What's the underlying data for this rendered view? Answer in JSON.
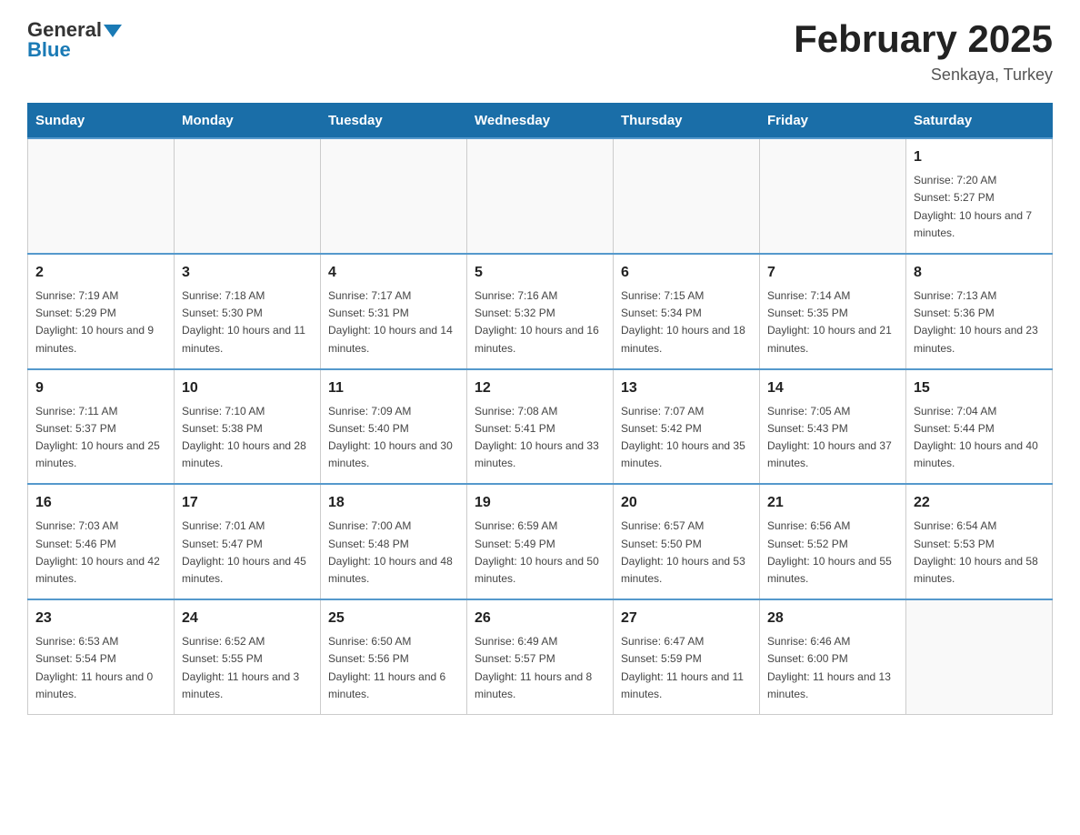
{
  "header": {
    "logo_general": "General",
    "logo_blue": "Blue",
    "title": "February 2025",
    "subtitle": "Senkaya, Turkey"
  },
  "days_of_week": [
    "Sunday",
    "Monday",
    "Tuesday",
    "Wednesday",
    "Thursday",
    "Friday",
    "Saturday"
  ],
  "weeks": [
    [
      {
        "day": "",
        "info": ""
      },
      {
        "day": "",
        "info": ""
      },
      {
        "day": "",
        "info": ""
      },
      {
        "day": "",
        "info": ""
      },
      {
        "day": "",
        "info": ""
      },
      {
        "day": "",
        "info": ""
      },
      {
        "day": "1",
        "info": "Sunrise: 7:20 AM\nSunset: 5:27 PM\nDaylight: 10 hours and 7 minutes."
      }
    ],
    [
      {
        "day": "2",
        "info": "Sunrise: 7:19 AM\nSunset: 5:29 PM\nDaylight: 10 hours and 9 minutes."
      },
      {
        "day": "3",
        "info": "Sunrise: 7:18 AM\nSunset: 5:30 PM\nDaylight: 10 hours and 11 minutes."
      },
      {
        "day": "4",
        "info": "Sunrise: 7:17 AM\nSunset: 5:31 PM\nDaylight: 10 hours and 14 minutes."
      },
      {
        "day": "5",
        "info": "Sunrise: 7:16 AM\nSunset: 5:32 PM\nDaylight: 10 hours and 16 minutes."
      },
      {
        "day": "6",
        "info": "Sunrise: 7:15 AM\nSunset: 5:34 PM\nDaylight: 10 hours and 18 minutes."
      },
      {
        "day": "7",
        "info": "Sunrise: 7:14 AM\nSunset: 5:35 PM\nDaylight: 10 hours and 21 minutes."
      },
      {
        "day": "8",
        "info": "Sunrise: 7:13 AM\nSunset: 5:36 PM\nDaylight: 10 hours and 23 minutes."
      }
    ],
    [
      {
        "day": "9",
        "info": "Sunrise: 7:11 AM\nSunset: 5:37 PM\nDaylight: 10 hours and 25 minutes."
      },
      {
        "day": "10",
        "info": "Sunrise: 7:10 AM\nSunset: 5:38 PM\nDaylight: 10 hours and 28 minutes."
      },
      {
        "day": "11",
        "info": "Sunrise: 7:09 AM\nSunset: 5:40 PM\nDaylight: 10 hours and 30 minutes."
      },
      {
        "day": "12",
        "info": "Sunrise: 7:08 AM\nSunset: 5:41 PM\nDaylight: 10 hours and 33 minutes."
      },
      {
        "day": "13",
        "info": "Sunrise: 7:07 AM\nSunset: 5:42 PM\nDaylight: 10 hours and 35 minutes."
      },
      {
        "day": "14",
        "info": "Sunrise: 7:05 AM\nSunset: 5:43 PM\nDaylight: 10 hours and 37 minutes."
      },
      {
        "day": "15",
        "info": "Sunrise: 7:04 AM\nSunset: 5:44 PM\nDaylight: 10 hours and 40 minutes."
      }
    ],
    [
      {
        "day": "16",
        "info": "Sunrise: 7:03 AM\nSunset: 5:46 PM\nDaylight: 10 hours and 42 minutes."
      },
      {
        "day": "17",
        "info": "Sunrise: 7:01 AM\nSunset: 5:47 PM\nDaylight: 10 hours and 45 minutes."
      },
      {
        "day": "18",
        "info": "Sunrise: 7:00 AM\nSunset: 5:48 PM\nDaylight: 10 hours and 48 minutes."
      },
      {
        "day": "19",
        "info": "Sunrise: 6:59 AM\nSunset: 5:49 PM\nDaylight: 10 hours and 50 minutes."
      },
      {
        "day": "20",
        "info": "Sunrise: 6:57 AM\nSunset: 5:50 PM\nDaylight: 10 hours and 53 minutes."
      },
      {
        "day": "21",
        "info": "Sunrise: 6:56 AM\nSunset: 5:52 PM\nDaylight: 10 hours and 55 minutes."
      },
      {
        "day": "22",
        "info": "Sunrise: 6:54 AM\nSunset: 5:53 PM\nDaylight: 10 hours and 58 minutes."
      }
    ],
    [
      {
        "day": "23",
        "info": "Sunrise: 6:53 AM\nSunset: 5:54 PM\nDaylight: 11 hours and 0 minutes."
      },
      {
        "day": "24",
        "info": "Sunrise: 6:52 AM\nSunset: 5:55 PM\nDaylight: 11 hours and 3 minutes."
      },
      {
        "day": "25",
        "info": "Sunrise: 6:50 AM\nSunset: 5:56 PM\nDaylight: 11 hours and 6 minutes."
      },
      {
        "day": "26",
        "info": "Sunrise: 6:49 AM\nSunset: 5:57 PM\nDaylight: 11 hours and 8 minutes."
      },
      {
        "day": "27",
        "info": "Sunrise: 6:47 AM\nSunset: 5:59 PM\nDaylight: 11 hours and 11 minutes."
      },
      {
        "day": "28",
        "info": "Sunrise: 6:46 AM\nSunset: 6:00 PM\nDaylight: 11 hours and 13 minutes."
      },
      {
        "day": "",
        "info": ""
      }
    ]
  ]
}
